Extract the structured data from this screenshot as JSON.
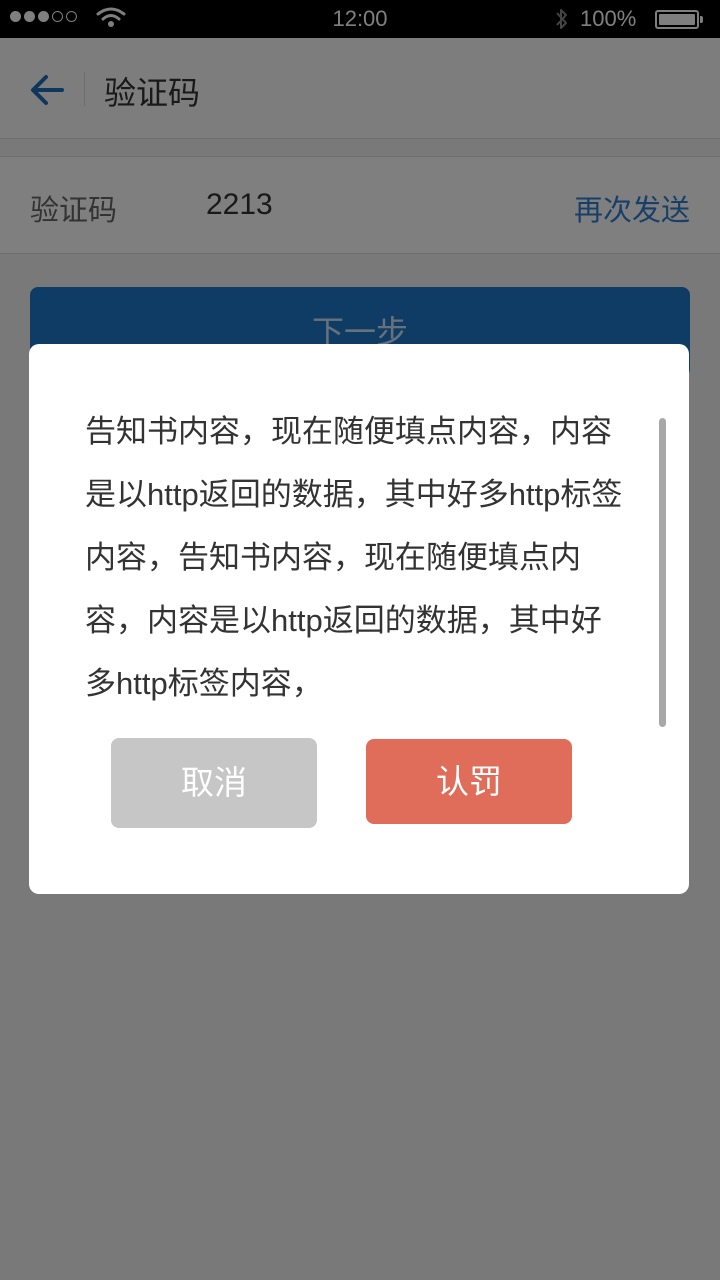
{
  "status_bar": {
    "time": "12:00",
    "battery_percent": "100%",
    "battery_level": 1.0,
    "signal_bars_filled": 3,
    "signal_bars_total": 5
  },
  "nav": {
    "title": "验证码",
    "back_icon": "arrow-left-icon"
  },
  "code_row": {
    "label": "验证码",
    "value": "2213",
    "resend_label": "再次发送"
  },
  "next_button": {
    "label": "下一步"
  },
  "dialog": {
    "notice_text": "告知书内容，现在随便填点内容，内容是以http返回的数据，其中好多http标签内容，告知书内容，现在随便填点内容，内容是以http返回的数据，其中好多http标签内容，",
    "cancel_label": "取消",
    "confirm_label": "认罚"
  },
  "colors": {
    "accent": "#1f79c9",
    "link": "#2e7fd1",
    "confirm": "#e06c5a",
    "cancel": "#c6c6c6"
  }
}
